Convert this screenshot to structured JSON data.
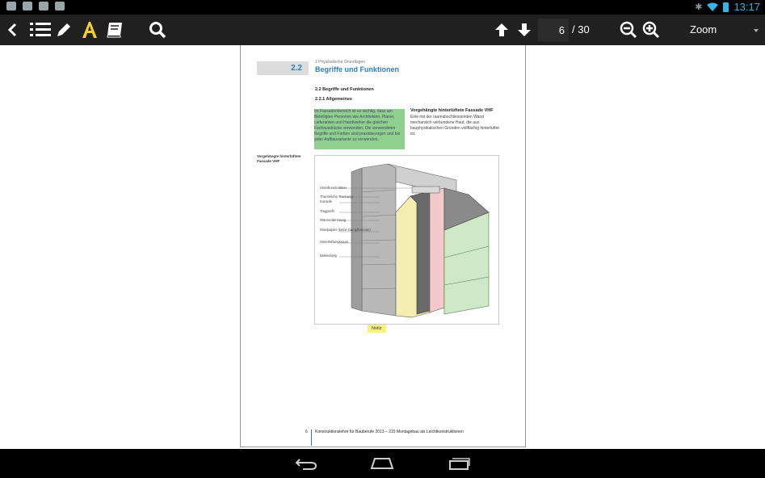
{
  "status_bar": {
    "time": "13:17",
    "icons": [
      "image-icon",
      "gamepad-icon",
      "clipboard-check-icon",
      "download-icon",
      "bluetooth-icon",
      "wifi-icon",
      "battery-icon"
    ]
  },
  "toolbar": {
    "current_page": "6",
    "page_total": "/ 30",
    "zoom_label": "Zoom",
    "accent": "#f5d02a"
  },
  "document": {
    "section_number": "2.2",
    "chapter_label": "2 Physikalische Grundlagen",
    "section_title": "Begriffe und Funktionen",
    "sub1": "2.2 Begriffe und Funktionen",
    "sub2": "2.2.1 Allgemeines",
    "highlight_text": "Im Fassadenbereich ist es wichtig, dass am Beteiligten Personen wie Architekten, Planer, Lieferanten und Handwerker die gleichen Fachausdrücke verwenden. Die verwendeten Begriffe und Farben sind praxisbezogen und bei jeder Aufbauvariante zu verwenden.",
    "vhf_heading": "Vorgehängte hinterlüftete Fassade VHF",
    "vhf_text": "Eine mit der raumabschliessenden Wand mechanisch verbundene Haut, die aus bauphysikalischen Gründen vollflächig hinterlüftet ist.",
    "figure_side_label": "Vorgehängte hinterlüftete Fassade VHF",
    "figure_labels": [
      "Unterkonstruktion",
      "Thermische Trennung",
      "Konsole",
      "Tragprofil",
      "Wärmedämmung",
      "Windpapier (keine Dampfbremse)",
      "Hinterlüftungsraum",
      "Bekleidung"
    ],
    "note_label": "Notiz",
    "footer_page": "6",
    "footer_text": "Konstruktionslehre für Bauberufe 2013 – 215 Montagebau als Leichtkonstruktionen",
    "highlight_color": "#8fd08e",
    "note_color": "#f7f27a"
  }
}
